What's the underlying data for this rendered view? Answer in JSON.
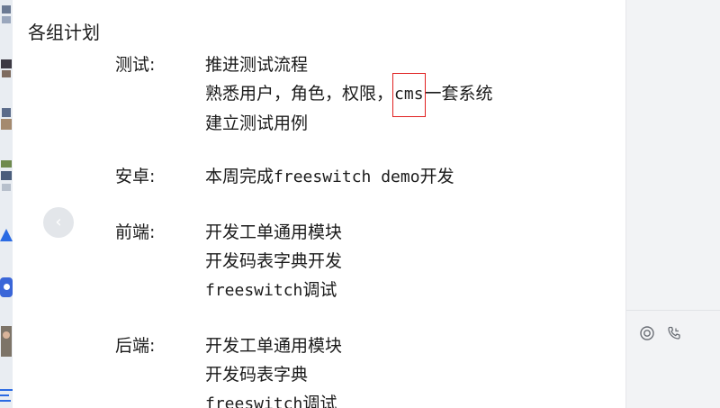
{
  "document": {
    "title": "各组计划",
    "sections": [
      {
        "label": "测试:",
        "lines": [
          {
            "text": "推进测试流程"
          },
          {
            "prefix": "熟悉用户，角色，权限，",
            "highlight": "cms",
            "suffix": "一套系统"
          },
          {
            "text": "建立测试用例"
          }
        ]
      },
      {
        "label": "安卓:",
        "lines": [
          {
            "prefix": "本周完成",
            "mono": "freeswitch demo",
            "suffix": "开发"
          }
        ]
      },
      {
        "label": "前端:",
        "lines": [
          {
            "text": "开发工单通用模块"
          },
          {
            "text": "开发码表字典开发"
          },
          {
            "mono": "freeswitch",
            "suffix": "调试"
          }
        ]
      },
      {
        "label": "后端:",
        "lines": [
          {
            "text": "开发工单通用模块"
          },
          {
            "text": "开发码表字典"
          },
          {
            "mono": "freeswitch",
            "suffix": "调试"
          }
        ]
      }
    ]
  },
  "nav": {
    "prev_glyph": "‹"
  },
  "right_panel": {
    "icons": [
      "record-icon",
      "phone-call-icon"
    ]
  },
  "colors": {
    "highlight_border": "#e02020",
    "panel_bg": "#f2f3f5"
  }
}
